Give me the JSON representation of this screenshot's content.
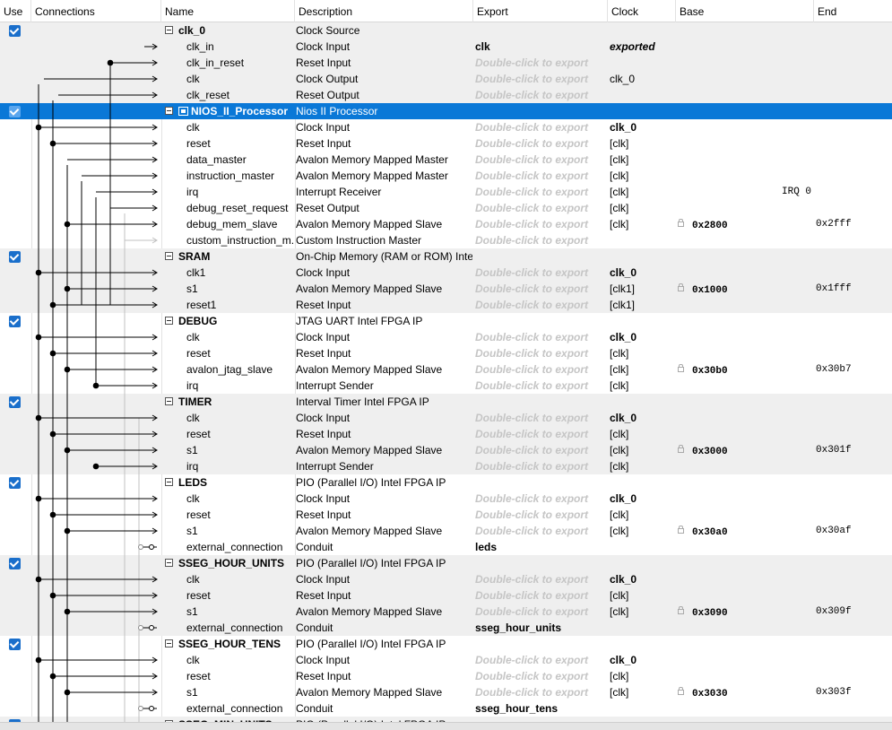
{
  "headers": {
    "use": "Use",
    "connections": "Connections",
    "name": "Name",
    "description": "Description",
    "export": "Export",
    "clock": "Clock",
    "base": "Base",
    "end": "End"
  },
  "export_hint": "Double-click to export",
  "rows": [
    {
      "kind": "comp",
      "name": "clk_0",
      "desc": "Clock Source",
      "export": "",
      "clock": "",
      "base": "",
      "end": "",
      "shaded": true
    },
    {
      "kind": "port",
      "name": "clk_in",
      "desc": "Clock Input",
      "export": "clk",
      "exportStyle": "val",
      "clock": "exported",
      "clockStyle": "italic",
      "shaded": true
    },
    {
      "kind": "port",
      "name": "clk_in_reset",
      "desc": "Reset Input",
      "export": "",
      "exportStyle": "hint",
      "clock": "",
      "shaded": true
    },
    {
      "kind": "port",
      "name": "clk",
      "desc": "Clock Output",
      "export": "",
      "exportStyle": "hint",
      "clock": "clk_0",
      "shaded": true
    },
    {
      "kind": "port",
      "name": "clk_reset",
      "desc": "Reset Output",
      "export": "",
      "exportStyle": "hint",
      "clock": "",
      "shaded": true
    },
    {
      "kind": "comp",
      "name": "NIOS_II_Processor",
      "desc": "Nios II Processor",
      "selected": true,
      "chip": true
    },
    {
      "kind": "port",
      "name": "clk",
      "desc": "Clock Input",
      "exportStyle": "hint",
      "clock": "clk_0",
      "clockStyle": "bold"
    },
    {
      "kind": "port",
      "name": "reset",
      "desc": "Reset Input",
      "exportStyle": "hint",
      "clock": "[clk]"
    },
    {
      "kind": "port",
      "name": "data_master",
      "desc": "Avalon Memory Mapped Master",
      "exportStyle": "hint",
      "clock": "[clk]"
    },
    {
      "kind": "port",
      "name": "instruction_master",
      "desc": "Avalon Memory Mapped Master",
      "exportStyle": "hint",
      "clock": "[clk]"
    },
    {
      "kind": "port",
      "name": "irq",
      "desc": "Interrupt Receiver",
      "exportStyle": "hint",
      "clock": "[clk]",
      "irq": "IRQ 0"
    },
    {
      "kind": "port",
      "name": "debug_reset_request",
      "desc": "Reset Output",
      "exportStyle": "hint",
      "clock": "[clk]"
    },
    {
      "kind": "port",
      "name": "debug_mem_slave",
      "desc": "Avalon Memory Mapped Slave",
      "exportStyle": "hint",
      "clock": "[clk]",
      "base": "0x2800",
      "end": "0x2fff"
    },
    {
      "kind": "port",
      "name": "custom_instruction_m...",
      "desc": "Custom Instruction Master",
      "exportStyle": "hint",
      "clock": ""
    },
    {
      "kind": "comp",
      "name": "SRAM",
      "desc": "On-Chip Memory (RAM or ROM) Intel ...",
      "shaded": true
    },
    {
      "kind": "port",
      "name": "clk1",
      "desc": "Clock Input",
      "exportStyle": "hint",
      "clock": "clk_0",
      "clockStyle": "bold",
      "shaded": true
    },
    {
      "kind": "port",
      "name": "s1",
      "desc": "Avalon Memory Mapped Slave",
      "exportStyle": "hint",
      "clock": "[clk1]",
      "base": "0x1000",
      "end": "0x1fff",
      "shaded": true
    },
    {
      "kind": "port",
      "name": "reset1",
      "desc": "Reset Input",
      "exportStyle": "hint",
      "clock": "[clk1]",
      "shaded": true
    },
    {
      "kind": "comp",
      "name": "DEBUG",
      "desc": "JTAG UART Intel FPGA IP"
    },
    {
      "kind": "port",
      "name": "clk",
      "desc": "Clock Input",
      "exportStyle": "hint",
      "clock": "clk_0",
      "clockStyle": "bold"
    },
    {
      "kind": "port",
      "name": "reset",
      "desc": "Reset Input",
      "exportStyle": "hint",
      "clock": "[clk]"
    },
    {
      "kind": "port",
      "name": "avalon_jtag_slave",
      "desc": "Avalon Memory Mapped Slave",
      "exportStyle": "hint",
      "clock": "[clk]",
      "base": "0x30b0",
      "end": "0x30b7"
    },
    {
      "kind": "port",
      "name": "irq",
      "desc": "Interrupt Sender",
      "exportStyle": "hint",
      "clock": "[clk]"
    },
    {
      "kind": "comp",
      "name": "TIMER",
      "desc": "Interval Timer Intel FPGA IP",
      "shaded": true
    },
    {
      "kind": "port",
      "name": "clk",
      "desc": "Clock Input",
      "exportStyle": "hint",
      "clock": "clk_0",
      "clockStyle": "bold",
      "shaded": true
    },
    {
      "kind": "port",
      "name": "reset",
      "desc": "Reset Input",
      "exportStyle": "hint",
      "clock": "[clk]",
      "shaded": true
    },
    {
      "kind": "port",
      "name": "s1",
      "desc": "Avalon Memory Mapped Slave",
      "exportStyle": "hint",
      "clock": "[clk]",
      "base": "0x3000",
      "end": "0x301f",
      "shaded": true
    },
    {
      "kind": "port",
      "name": "irq",
      "desc": "Interrupt Sender",
      "exportStyle": "hint",
      "clock": "[clk]",
      "shaded": true
    },
    {
      "kind": "comp",
      "name": "LEDS",
      "desc": "PIO (Parallel I/O) Intel FPGA IP"
    },
    {
      "kind": "port",
      "name": "clk",
      "desc": "Clock Input",
      "exportStyle": "hint",
      "clock": "clk_0",
      "clockStyle": "bold"
    },
    {
      "kind": "port",
      "name": "reset",
      "desc": "Reset Input",
      "exportStyle": "hint",
      "clock": "[clk]"
    },
    {
      "kind": "port",
      "name": "s1",
      "desc": "Avalon Memory Mapped Slave",
      "exportStyle": "hint",
      "clock": "[clk]",
      "base": "0x30a0",
      "end": "0x30af"
    },
    {
      "kind": "port",
      "name": "external_connection",
      "desc": "Conduit",
      "export": "leds",
      "exportStyle": "val",
      "clock": ""
    },
    {
      "kind": "comp",
      "name": "SSEG_HOUR_UNITS",
      "desc": "PIO (Parallel I/O) Intel FPGA IP",
      "shaded": true
    },
    {
      "kind": "port",
      "name": "clk",
      "desc": "Clock Input",
      "exportStyle": "hint",
      "clock": "clk_0",
      "clockStyle": "bold",
      "shaded": true
    },
    {
      "kind": "port",
      "name": "reset",
      "desc": "Reset Input",
      "exportStyle": "hint",
      "clock": "[clk]",
      "shaded": true
    },
    {
      "kind": "port",
      "name": "s1",
      "desc": "Avalon Memory Mapped Slave",
      "exportStyle": "hint",
      "clock": "[clk]",
      "base": "0x3090",
      "end": "0x309f",
      "shaded": true
    },
    {
      "kind": "port",
      "name": "external_connection",
      "desc": "Conduit",
      "export": "sseg_hour_units",
      "exportStyle": "val",
      "clock": "",
      "shaded": true
    },
    {
      "kind": "comp",
      "name": "SSEG_HOUR_TENS",
      "desc": "PIO (Parallel I/O) Intel FPGA IP"
    },
    {
      "kind": "port",
      "name": "clk",
      "desc": "Clock Input",
      "exportStyle": "hint",
      "clock": "clk_0",
      "clockStyle": "bold"
    },
    {
      "kind": "port",
      "name": "reset",
      "desc": "Reset Input",
      "exportStyle": "hint",
      "clock": "[clk]"
    },
    {
      "kind": "port",
      "name": "s1",
      "desc": "Avalon Memory Mapped Slave",
      "exportStyle": "hint",
      "clock": "[clk]",
      "base": "0x3030",
      "end": "0x303f"
    },
    {
      "kind": "port",
      "name": "external_connection",
      "desc": "Conduit",
      "export": "sseg_hour_tens",
      "exportStyle": "val",
      "clock": ""
    },
    {
      "kind": "comp",
      "name": "SSEG_MIN_UNITS",
      "desc": "PIO (Parallel I/O) Intel FPGA IP",
      "shaded": true
    }
  ],
  "colors": {
    "selected": "#0a78d7",
    "checkbox": "#1a6fcb",
    "hint": "#c5c5c5",
    "shaded": "#efefef"
  }
}
